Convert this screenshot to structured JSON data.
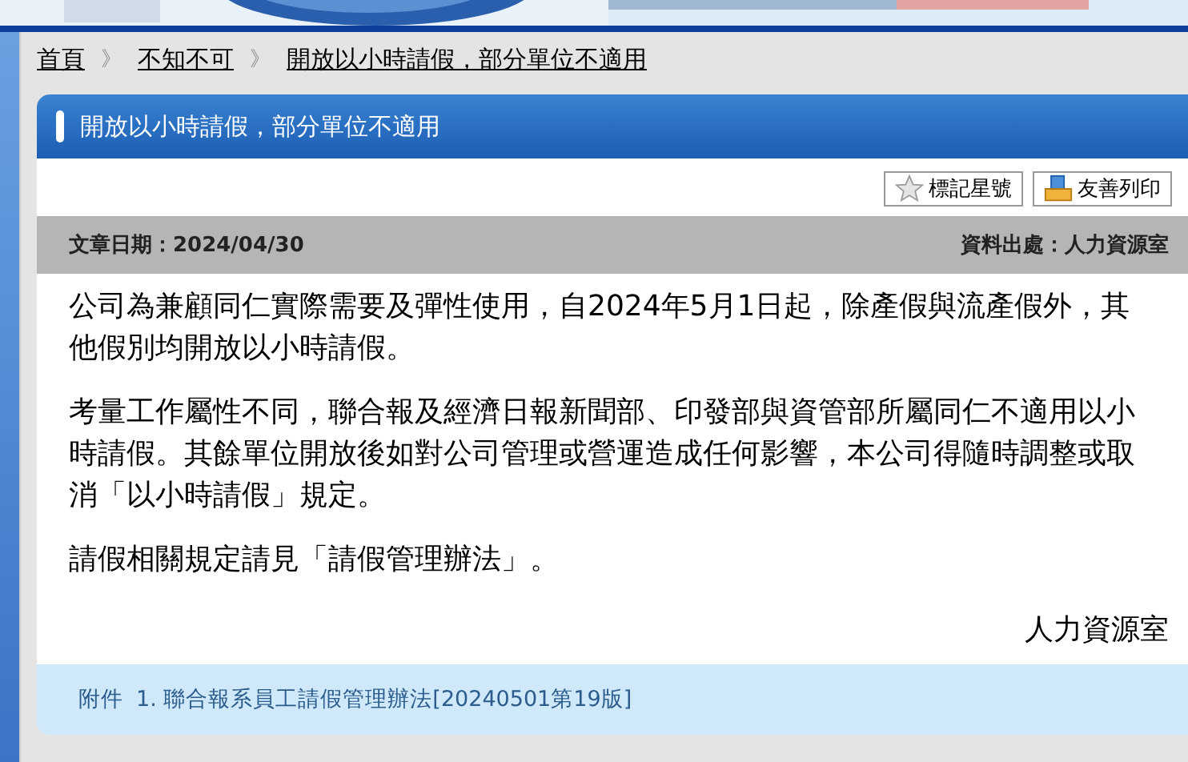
{
  "breadcrumb": [
    {
      "label": "首頁"
    },
    {
      "label": "不知不可"
    },
    {
      "label": "開放以小時請假，部分單位不適用"
    }
  ],
  "breadcrumb_separator": "》",
  "article": {
    "title": "開放以小時請假，部分單位不適用",
    "buttons": [
      {
        "label": "標記星號",
        "kind": "star"
      },
      {
        "label": "友善列印",
        "kind": "print"
      }
    ],
    "date": "文章日期：2024/04/30",
    "source": "資料出處：人力資源室",
    "paragraphs": [
      "公司為兼顧同仁實際需要及彈性使用，自2024年5月1日起，除產假與流產假外，其他假別均開放以小時請假。",
      "考量工作屬性不同，聯合報及經濟日報新聞部、印發部與資管部所屬同仁不適用以小時請假。其餘單位開放後如對公司管理或營運造成任何影響，本公司得隨時調整或取消「以小時請假」規定。",
      "請假相關規定請見「請假管理辦法」。"
    ],
    "signature": "人力資源室",
    "attachment_label": "附件",
    "attachments": [
      "1. 聯合報系員工請假管理辦法[20240501第19版]"
    ]
  }
}
